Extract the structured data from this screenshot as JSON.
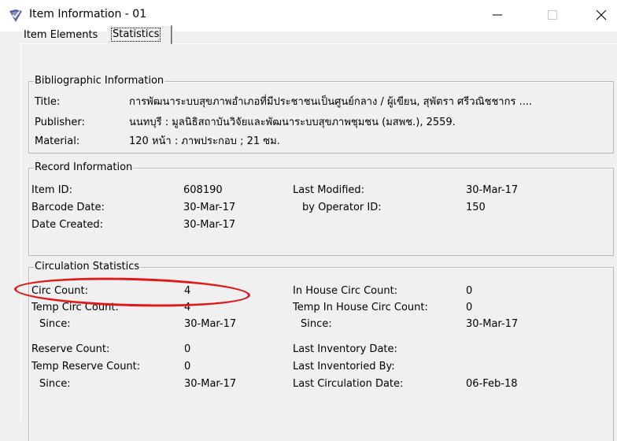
{
  "window": {
    "title": "Item Information - 01",
    "app_icon": "check-shield-icon",
    "controls": [
      "minimize-icon",
      "maximize-icon",
      "close-icon"
    ]
  },
  "tabs": [
    {
      "label": "Item Elements",
      "active": false
    },
    {
      "label": "Statistics",
      "active": true
    }
  ],
  "bibliographic": {
    "legend": "Bibliographic Information",
    "title_label": "Title:",
    "title_value": "การพัฒนาระบบสุขภาพอำเภอที่มีประชาชนเป็นศูนย์กลาง / ผู้เขียน, สุพัตรา ศรีวณิชชากร ....",
    "publisher_label": "Publisher:",
    "publisher_value": "นนทบุรี : มูลนิธิสถาบันวิจัยและพัฒนาระบบสุขภาพชุมชน (มสพช.), 2559.",
    "material_label": "Material:",
    "material_value": "120 หน้า : ภาพประกอบ ; 21 ซม."
  },
  "record": {
    "legend": "Record Information",
    "item_id_label": "Item ID:",
    "item_id_value": "608190",
    "barcode_date_label": "Barcode Date:",
    "barcode_date_value": "30-Mar-17",
    "date_created_label": "Date Created:",
    "date_created_value": "30-Mar-17",
    "last_modified_label": "Last Modified:",
    "last_modified_value": "30-Mar-17",
    "operator_label": "by Operator ID:",
    "operator_value": "150"
  },
  "circulation": {
    "legend": "Circulation Statistics",
    "circ_count_label": "Circ Count:",
    "circ_count_value": "4",
    "temp_circ_label": "Temp Circ Count:",
    "temp_circ_value": "4",
    "since1_label": "Since:",
    "since1_value": "30-Mar-17",
    "reserve_label": "Reserve Count:",
    "reserve_value": "0",
    "temp_reserve_label": "Temp Reserve Count:",
    "temp_reserve_value": "0",
    "since2_label": "Since:",
    "since2_value": "30-Mar-17",
    "in_house_label": "In House Circ Count:",
    "in_house_value": "0",
    "temp_in_house_label": "Temp In House Circ Count:",
    "temp_in_house_value": "0",
    "since3_label": "Since:",
    "since3_value": "30-Mar-17",
    "last_inventory_label": "Last Inventory Date:",
    "last_inventory_value": "",
    "last_inventoried_by_label": "Last Inventoried By:",
    "last_inventoried_by_value": "",
    "last_circ_date_label": "Last Circulation Date:",
    "last_circ_date_value": "06-Feb-18"
  },
  "annotation": {
    "shape": "ellipse",
    "color": "#e01818"
  }
}
